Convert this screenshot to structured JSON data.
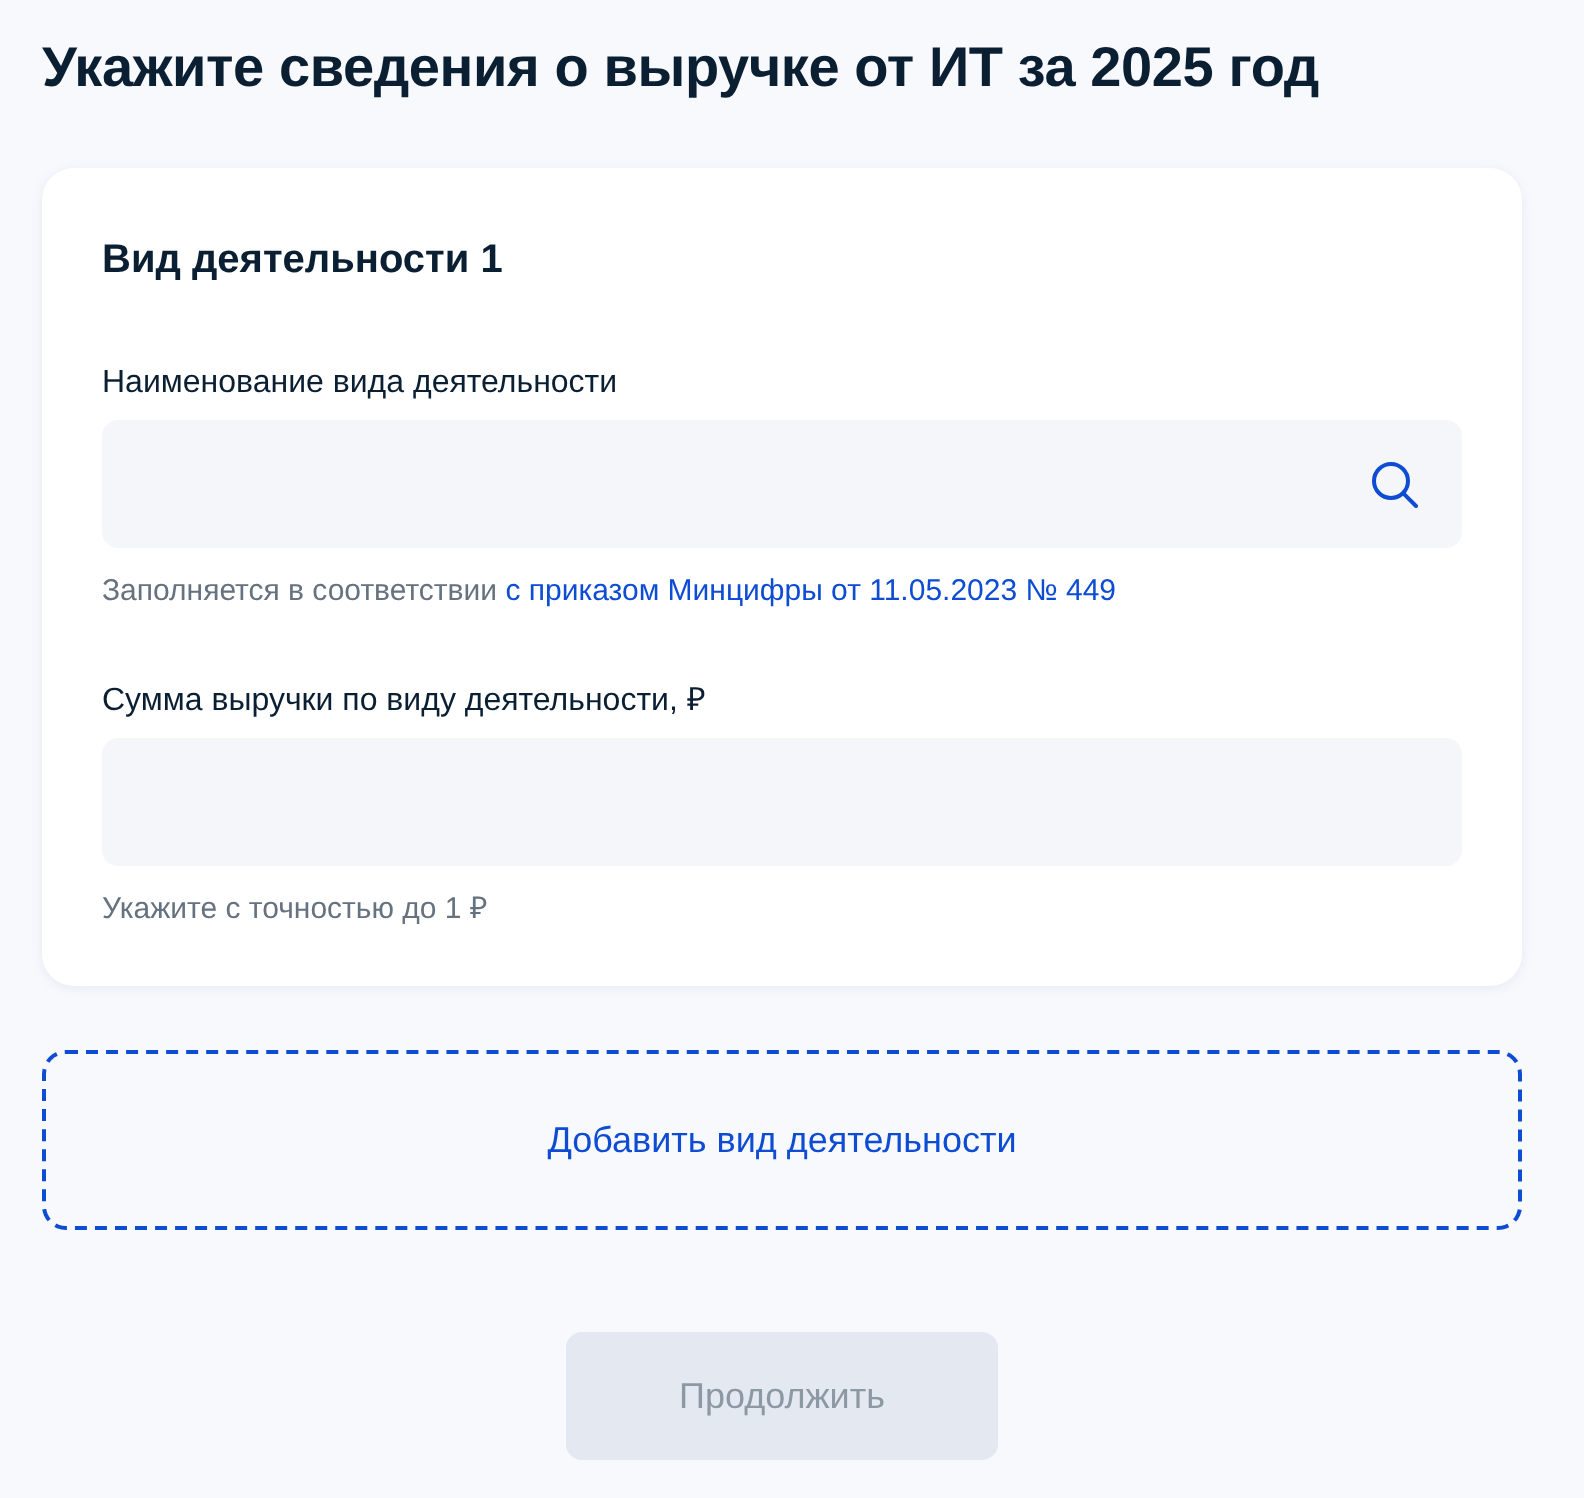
{
  "title": "Укажите сведения о выручке от ИТ за 2025 год",
  "activities": [
    {
      "heading": "Вид деятельности 1",
      "fields": [
        {
          "kind": "search",
          "label": "Наименование вида деятельности",
          "hint": "Заполняется в соответствии",
          "hint_link": "с приказом Минцифры от 11.05.2023 № 449"
        },
        {
          "kind": "text",
          "label": "Сумма выручки по виду деятельности, ₽",
          "hint": "Укажите с точностью до 1 ₽"
        }
      ]
    }
  ],
  "add_button": {
    "label": "Добавить вид деятельности"
  },
  "continue_button": {
    "label": "Продолжить",
    "disabled": true
  }
}
